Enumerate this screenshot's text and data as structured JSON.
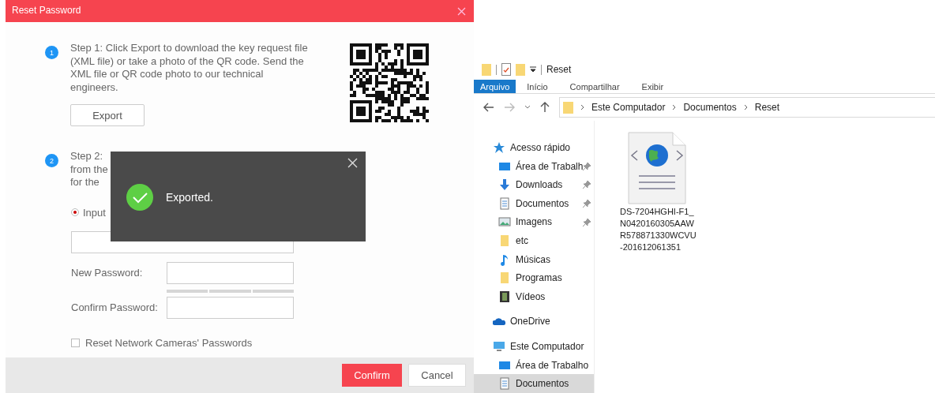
{
  "dialog": {
    "title": "Reset Password",
    "steps": [
      {
        "number": "1",
        "text": "Step 1: Click Export to download the key request file (XML file) or take a photo of the QR code. Send the XML file or QR code photo to our technical engineers.",
        "button": "Export"
      },
      {
        "number": "2",
        "lines": [
          "Step 2:",
          "from the",
          "for the"
        ]
      }
    ],
    "key_source": [
      {
        "label": "Input",
        "selected": true
      }
    ],
    "fields": [
      {
        "label": "New Password:",
        "strength_meter": true
      },
      {
        "label": "Confirm Password:",
        "strength_meter": false
      }
    ],
    "reset_cameras": {
      "label": "Reset Network Cameras' Passwords",
      "checked": false
    },
    "buttons": [
      {
        "label": "Confirm",
        "kind": "primary"
      },
      {
        "label": "Cancel",
        "kind": "secondary"
      }
    ]
  },
  "toast": {
    "message": "Exported."
  },
  "explorer": {
    "title": "Reset",
    "ribbon_tabs": [
      {
        "label": "Arquivo",
        "selected": true
      },
      {
        "label": "Início",
        "selected": false
      },
      {
        "label": "Compartilhar",
        "selected": false
      },
      {
        "label": "Exibir",
        "selected": false
      }
    ],
    "breadcrumb": [
      "Este Computador",
      "Documentos",
      "Reset"
    ],
    "nav": [
      {
        "label": "Acesso rápido",
        "kind": "star",
        "selected": false,
        "children": [
          {
            "label": "Área de Trabalh",
            "kind": "desktop",
            "pinned": true,
            "selected": false
          },
          {
            "label": "Downloads",
            "kind": "download",
            "pinned": true,
            "selected": false
          },
          {
            "label": "Documentos",
            "kind": "document",
            "pinned": true,
            "selected": false
          },
          {
            "label": "Imagens",
            "kind": "picture",
            "pinned": true,
            "selected": false
          },
          {
            "label": "etc",
            "kind": "folder",
            "pinned": false,
            "selected": false
          },
          {
            "label": "Músicas",
            "kind": "music",
            "pinned": false,
            "selected": false
          },
          {
            "label": "Programas",
            "kind": "folder",
            "pinned": false,
            "selected": false
          },
          {
            "label": "Vídeos",
            "kind": "video",
            "pinned": false,
            "selected": false
          }
        ]
      },
      {
        "label": "OneDrive",
        "kind": "cloud",
        "selected": false
      },
      {
        "label": "Este Computador",
        "kind": "computer",
        "selected": false,
        "children": [
          {
            "label": "Área de Trabalho",
            "kind": "desktop",
            "pinned": false,
            "selected": false
          },
          {
            "label": "Documentos",
            "kind": "document",
            "pinned": false,
            "selected": true
          }
        ]
      }
    ],
    "files": [
      {
        "name": "DS-7204HGHI-F1_N0420160305AAWR578871330WCVU-201612061351"
      }
    ]
  }
}
